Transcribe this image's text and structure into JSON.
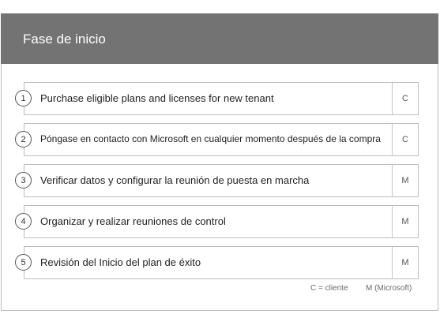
{
  "header": {
    "title": "Fase de inicio"
  },
  "steps": [
    {
      "number": "1",
      "label": "Purchase eligible plans and licenses for new tenant",
      "code": "C"
    },
    {
      "number": "2",
      "label": "Póngase en contacto con Microsoft en cualquier momento después de la compra",
      "code": "C"
    },
    {
      "number": "3",
      "label": "Verificar datos y configurar la reunión de puesta en marcha",
      "code": "M"
    },
    {
      "number": "4",
      "label": "Organizar y realizar reuniones de control",
      "code": "M"
    },
    {
      "number": "5",
      "label": "Revisión del Inicio del plan de éxito",
      "code": "M"
    }
  ],
  "legend": {
    "client": "C = cliente",
    "microsoft": "M (Microsoft)"
  },
  "colors": {
    "header_bg": "#737373",
    "border": "#bdbdbd"
  }
}
